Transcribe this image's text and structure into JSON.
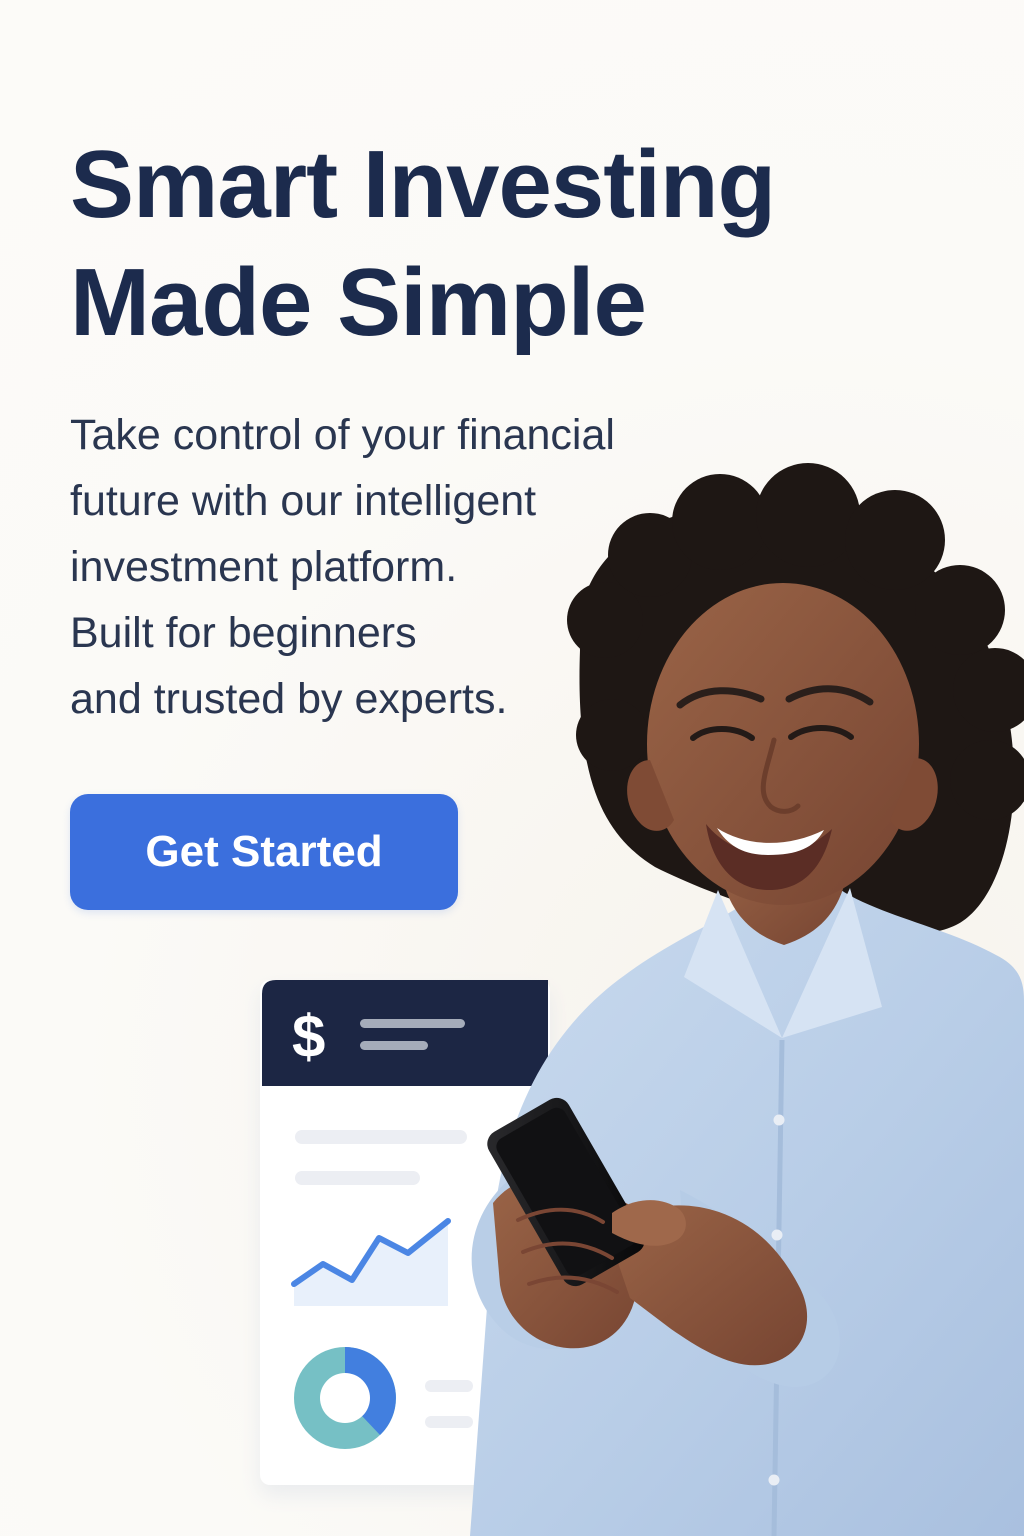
{
  "hero": {
    "title_lines": [
      "Smart Investing",
      "Made Simple"
    ],
    "subtitle_lines": [
      "Take control of your financial",
      "future with our intelligent",
      "investment platform.",
      "Built for beginners",
      "and trusted by experts."
    ],
    "cta_label": "Get Started"
  },
  "finance_card": {
    "symbol": "$",
    "icon": "trend-line-icon",
    "donut_icon": "donut-chart-icon"
  },
  "colors": {
    "title": "#1C2B4D",
    "body": "#2A3650",
    "button": "#3B6FDD",
    "card_header": "#1C2644",
    "shirt": "#BFD2EA",
    "hair": "#1E1714",
    "skin": "#8D573C"
  }
}
